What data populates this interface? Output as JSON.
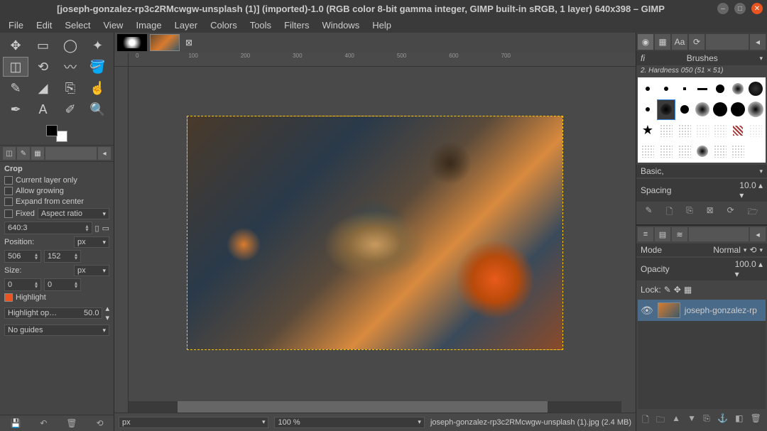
{
  "title": "[joseph-gonzalez-rp3c2RMcwgw-unsplash (1)] (imported)-1.0 (RGB color 8-bit gamma integer, GIMP built-in sRGB, 1 layer) 640x398 – GIMP",
  "menu": {
    "file": "File",
    "edit": "Edit",
    "select": "Select",
    "view": "View",
    "image": "Image",
    "layer": "Layer",
    "colors": "Colors",
    "tools": "Tools",
    "filters": "Filters",
    "windows": "Windows",
    "help": "Help"
  },
  "toolopts": {
    "title": "Crop",
    "current_layer": "Current layer only",
    "allow_grow": "Allow growing",
    "expand_center": "Expand from center",
    "fixed": "Fixed",
    "aspect": "Aspect ratio",
    "ratio": "640:3",
    "position": "Position:",
    "px": "px",
    "pos_x": "506",
    "pos_y": "152",
    "size": "Size:",
    "size_w": "0",
    "size_h": "0",
    "highlight": "Highlight",
    "highlight_op": "Highlight op…",
    "highlight_val": "50.0",
    "no_guides": "No guides"
  },
  "status": {
    "px": "px",
    "zoom": "100 %",
    "file": "joseph-gonzalez-rp3c2RMcwgw-unsplash (1).jpg (2.4 MB)"
  },
  "brushes": {
    "title": "Brushes",
    "info": "2. Hardness 050 (51 × 51)",
    "preset": "Basic,",
    "spacing": "Spacing",
    "spacing_val": "10.0"
  },
  "layers": {
    "mode": "Mode",
    "mode_val": "Normal",
    "opacity": "Opacity",
    "opacity_val": "100.0",
    "lock": "Lock:",
    "layer_name": "joseph-gonzalez-rp"
  }
}
